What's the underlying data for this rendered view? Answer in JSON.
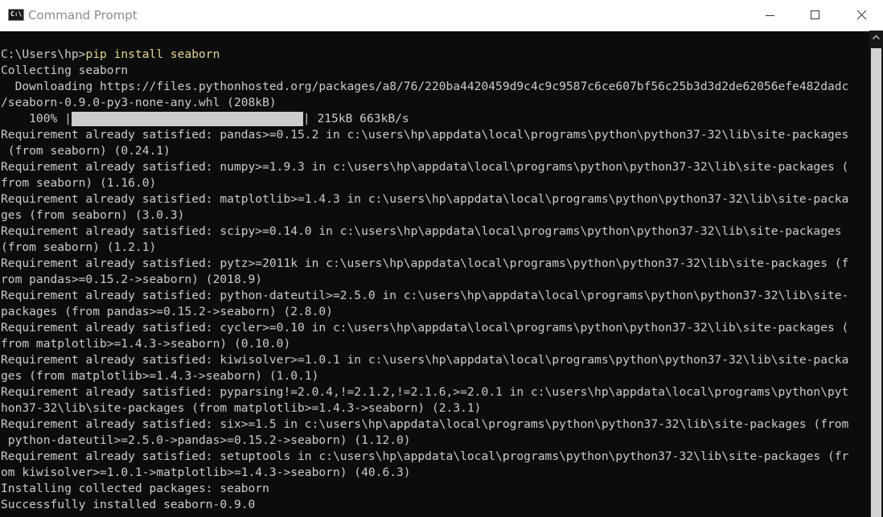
{
  "window": {
    "title": "Command Prompt",
    "icon_text": "C:\\",
    "controls": [
      "minimize",
      "maximize",
      "close"
    ]
  },
  "console": {
    "prompt": "C:\\Users\\hp>",
    "command": "pip install seaborn",
    "lines": [
      "Collecting seaborn",
      "  Downloading https://files.pythonhosted.org/packages/a8/76/220ba4420459d9c4c9c9587c6ce607bf56c25b3d3d2de62056efe482dadc",
      "/seaborn-0.9.0-py3-none-any.whl (208kB)"
    ],
    "progress": {
      "percent_text": "    100% ",
      "fraction": 1.0,
      "edge_left": "|",
      "edge_right": "|",
      "stats": " 215kB 663kB/s"
    },
    "lines_after": [
      "Requirement already satisfied: pandas>=0.15.2 in c:\\users\\hp\\appdata\\local\\programs\\python\\python37-32\\lib\\site-packages",
      " (from seaborn) (0.24.1)",
      "Requirement already satisfied: numpy>=1.9.3 in c:\\users\\hp\\appdata\\local\\programs\\python\\python37-32\\lib\\site-packages (",
      "from seaborn) (1.16.0)",
      "Requirement already satisfied: matplotlib>=1.4.3 in c:\\users\\hp\\appdata\\local\\programs\\python\\python37-32\\lib\\site-packa",
      "ges (from seaborn) (3.0.3)",
      "Requirement already satisfied: scipy>=0.14.0 in c:\\users\\hp\\appdata\\local\\programs\\python\\python37-32\\lib\\site-packages",
      "(from seaborn) (1.2.1)",
      "Requirement already satisfied: pytz>=2011k in c:\\users\\hp\\appdata\\local\\programs\\python\\python37-32\\lib\\site-packages (f",
      "rom pandas>=0.15.2->seaborn) (2018.9)",
      "Requirement already satisfied: python-dateutil>=2.5.0 in c:\\users\\hp\\appdata\\local\\programs\\python\\python37-32\\lib\\site-",
      "packages (from pandas>=0.15.2->seaborn) (2.8.0)",
      "Requirement already satisfied: cycler>=0.10 in c:\\users\\hp\\appdata\\local\\programs\\python\\python37-32\\lib\\site-packages (",
      "from matplotlib>=1.4.3->seaborn) (0.10.0)",
      "Requirement already satisfied: kiwisolver>=1.0.1 in c:\\users\\hp\\appdata\\local\\programs\\python\\python37-32\\lib\\site-packa",
      "ges (from matplotlib>=1.4.3->seaborn) (1.0.1)",
      "Requirement already satisfied: pyparsing!=2.0.4,!=2.1.2,!=2.1.6,>=2.0.1 in c:\\users\\hp\\appdata\\local\\programs\\python\\pyt",
      "hon37-32\\lib\\site-packages (from matplotlib>=1.4.3->seaborn) (2.3.1)",
      "Requirement already satisfied: six>=1.5 in c:\\users\\hp\\appdata\\local\\programs\\python\\python37-32\\lib\\site-packages (from",
      " python-dateutil>=2.5.0->pandas>=0.15.2->seaborn) (1.12.0)",
      "Requirement already satisfied: setuptools in c:\\users\\hp\\appdata\\local\\programs\\python\\python37-32\\lib\\site-packages (fr",
      "om kiwisolver>=1.0.1->matplotlib>=1.4.3->seaborn) (40.6.3)",
      "Installing collected packages: seaborn",
      "Successfully installed seaborn-0.9.0"
    ]
  },
  "colors": {
    "console_bg": "#0c0c0c",
    "console_text": "#cccccc",
    "command_text": "#e5d58d",
    "titlebar_bg": "#ffffff",
    "title_text": "#8c8c8c"
  }
}
